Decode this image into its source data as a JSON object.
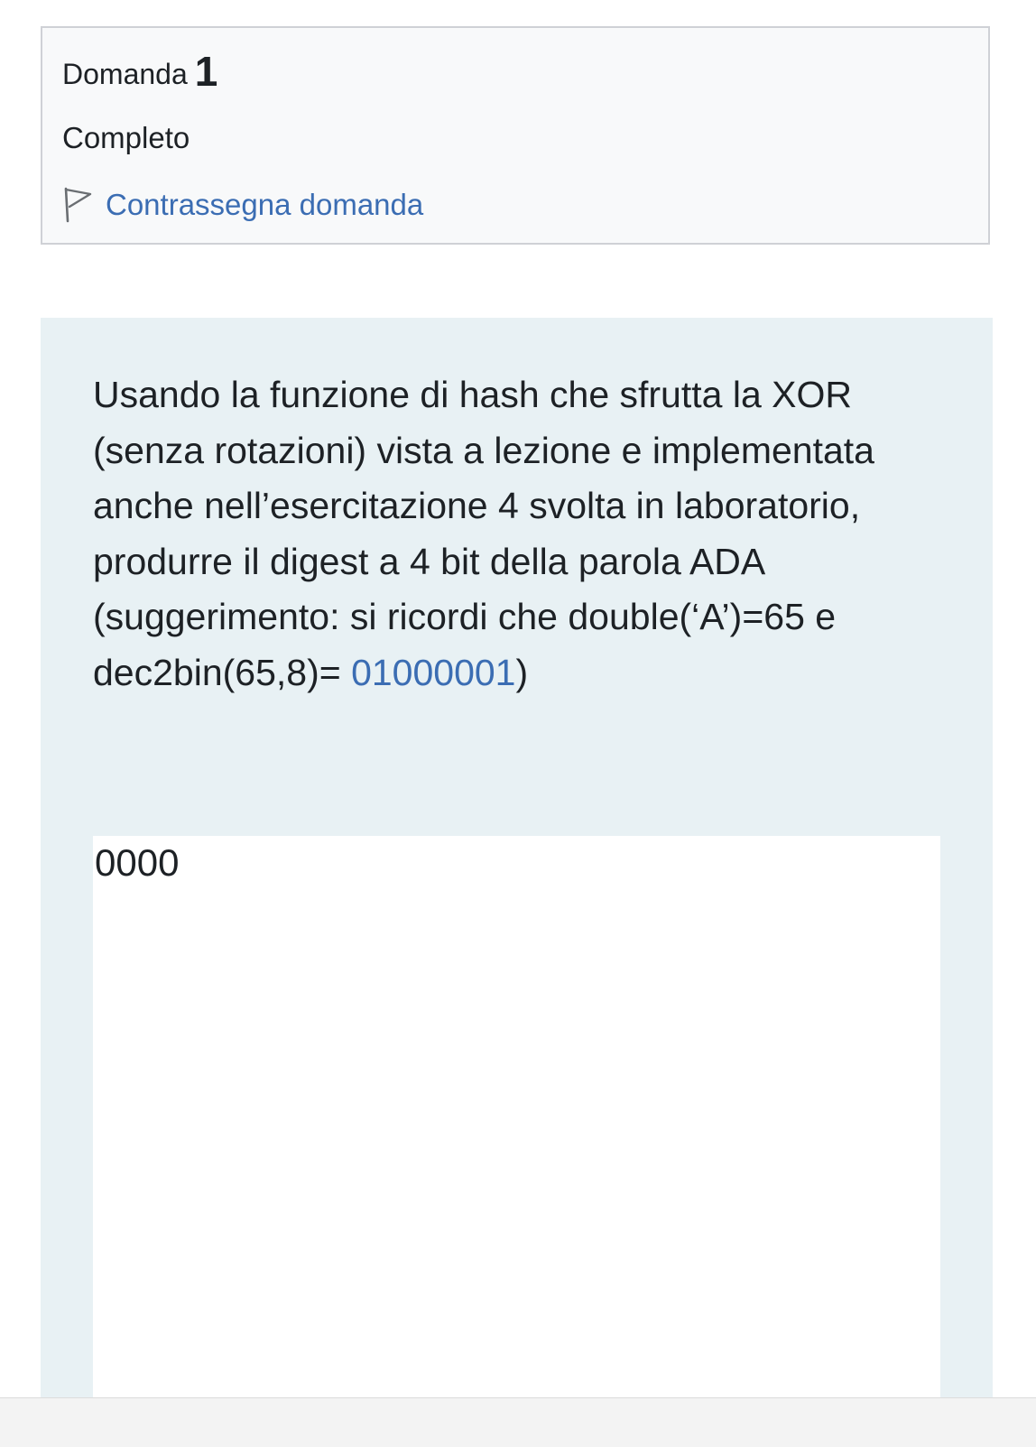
{
  "question_info": {
    "label": "Domanda",
    "number": "1",
    "state": "Completo",
    "flag_label": "Contrassegna domanda"
  },
  "question": {
    "text_before_highlight": "Usando la funzione di hash che sfrutta la XOR (senza rotazioni) vista a lezione e implementata anche nell’esercitazione 4 svolta in laboratorio, produrre il digest a 4 bit della parola ADA (suggerimento: si ricordi che double(‘A’)=65 e dec2bin(65,8)= ",
    "highlight": "01000001",
    "text_after_highlight": ")"
  },
  "answer": {
    "value": "0000"
  },
  "colors": {
    "link": "#3b6db3",
    "info_background": "#f8f9fa",
    "content_background": "#e8f1f4"
  },
  "icons": {
    "flag": "flag-outline-icon"
  }
}
